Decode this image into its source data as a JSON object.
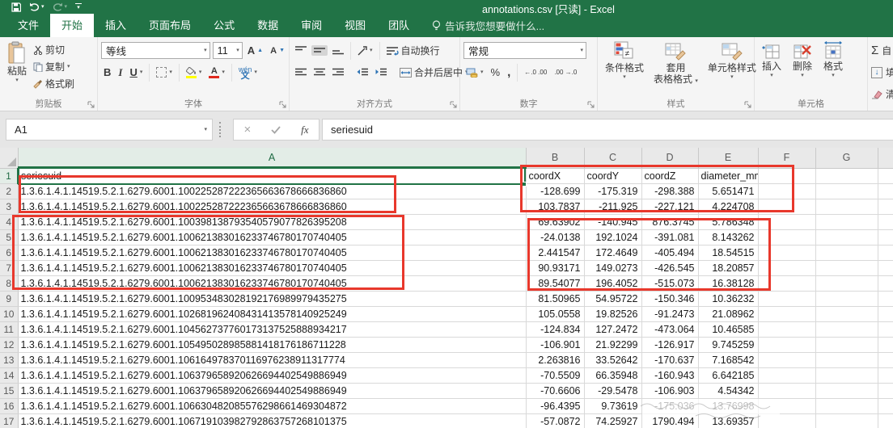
{
  "colors": {
    "excel_green": "#217346",
    "annotation_red": "#E8382C",
    "selection_green": "#217346"
  },
  "title_bar": {
    "title": "annotations.csv  [只读] - Excel"
  },
  "qat": {
    "icons": [
      "save-icon",
      "undo-icon",
      "redo-icon",
      "customize-quick-access-icon"
    ]
  },
  "ribbon": {
    "tabs": [
      {
        "label": "文件",
        "active": false
      },
      {
        "label": "开始",
        "active": true
      },
      {
        "label": "插入",
        "active": false
      },
      {
        "label": "页面布局",
        "active": false
      },
      {
        "label": "公式",
        "active": false
      },
      {
        "label": "数据",
        "active": false
      },
      {
        "label": "审阅",
        "active": false
      },
      {
        "label": "视图",
        "active": false
      },
      {
        "label": "团队",
        "active": false
      }
    ],
    "tell_me": "告诉我您想要做什么...",
    "clipboard": {
      "group_label": "剪贴板",
      "paste": "粘贴",
      "cut": "剪切",
      "copy": "复制",
      "format_painter": "格式刷"
    },
    "font": {
      "group_label": "字体",
      "font_name": "等线",
      "font_size": "11",
      "bold": "B",
      "italic": "I",
      "underline": "U",
      "phonetic_top": "wén",
      "phonetic_bottom": "文"
    },
    "alignment": {
      "group_label": "对齐方式",
      "wrap_text": "自动换行",
      "merge_center": "合并后居中"
    },
    "number": {
      "group_label": "数字",
      "format": "常规",
      "percent": "%",
      "comma": ",",
      "inc_decimal": "←.0 .00",
      "dec_decimal": ".00 →.0"
    },
    "styles": {
      "group_label": "样式",
      "conditional": "条件格式",
      "format_as_table_1": "套用",
      "format_as_table_2": "表格格式",
      "cell_styles": "单元格样式"
    },
    "cells": {
      "group_label": "单元格",
      "insert": "插入",
      "delete": "删除",
      "format": "格式"
    },
    "editing": {
      "autosum_sigma": "Σ",
      "autosum_partial": "自",
      "fill_partial": "填",
      "clear_partial": "清"
    }
  },
  "formula_bar": {
    "name_box": "A1",
    "fx": "fx",
    "formula": "seriesuid"
  },
  "grid": {
    "column_letters": [
      "A",
      "B",
      "C",
      "D",
      "E",
      "F",
      "G",
      ""
    ],
    "selected_cell": "A1",
    "rows": [
      {
        "n": "1",
        "cells": [
          "seriesuid",
          "coordX",
          "coordY",
          "coordZ",
          "diameter_mm"
        ]
      },
      {
        "n": "2",
        "cells": [
          "1.3.6.1.4.1.14519.5.2.1.6279.6001.100225287222365663678666836860",
          "-128.699",
          "-175.319",
          "-298.388",
          "5.651471"
        ]
      },
      {
        "n": "3",
        "cells": [
          "1.3.6.1.4.1.14519.5.2.1.6279.6001.100225287222365663678666836860",
          "103.7837",
          "-211.925",
          "-227.121",
          "4.224708"
        ]
      },
      {
        "n": "4",
        "cells": [
          "1.3.6.1.4.1.14519.5.2.1.6279.6001.100398138793540579077826395208",
          "69.63902",
          "-140.945",
          "876.3745",
          "5.786348"
        ]
      },
      {
        "n": "5",
        "cells": [
          "1.3.6.1.4.1.14519.5.2.1.6279.6001.100621383016233746780170740405",
          "-24.0138",
          "192.1024",
          "-391.081",
          "8.143262"
        ]
      },
      {
        "n": "6",
        "cells": [
          "1.3.6.1.4.1.14519.5.2.1.6279.6001.100621383016233746780170740405",
          "2.441547",
          "172.4649",
          "-405.494",
          "18.54515"
        ]
      },
      {
        "n": "7",
        "cells": [
          "1.3.6.1.4.1.14519.5.2.1.6279.6001.100621383016233746780170740405",
          "90.93171",
          "149.0273",
          "-426.545",
          "18.20857"
        ]
      },
      {
        "n": "8",
        "cells": [
          "1.3.6.1.4.1.14519.5.2.1.6279.6001.100621383016233746780170740405",
          "89.54077",
          "196.4052",
          "-515.073",
          "16.38128"
        ]
      },
      {
        "n": "9",
        "cells": [
          "1.3.6.1.4.1.14519.5.2.1.6279.6001.100953483028192176989979435275",
          "81.50965",
          "54.95722",
          "-150.346",
          "10.36232"
        ]
      },
      {
        "n": "10",
        "cells": [
          "1.3.6.1.4.1.14519.5.2.1.6279.6001.102681962408431413578140925249",
          "105.0558",
          "19.82526",
          "-91.2473",
          "21.08962"
        ]
      },
      {
        "n": "11",
        "cells": [
          "1.3.6.1.4.1.14519.5.2.1.6279.6001.104562737760173137525888934217",
          "-124.834",
          "127.2472",
          "-473.064",
          "10.46585"
        ]
      },
      {
        "n": "12",
        "cells": [
          "1.3.6.1.4.1.14519.5.2.1.6279.6001.105495028985881418176186711228",
          "-106.901",
          "21.92299",
          "-126.917",
          "9.745259"
        ]
      },
      {
        "n": "13",
        "cells": [
          "1.3.6.1.4.1.14519.5.2.1.6279.6001.106164978370116976238911317774",
          "2.263816",
          "33.52642",
          "-170.637",
          "7.168542"
        ]
      },
      {
        "n": "14",
        "cells": [
          "1.3.6.1.4.1.14519.5.2.1.6279.6001.106379658920626694402549886949",
          "-70.5509",
          "66.35948",
          "-160.943",
          "6.642185"
        ]
      },
      {
        "n": "15",
        "cells": [
          "1.3.6.1.4.1.14519.5.2.1.6279.6001.106379658920626694402549886949",
          "-70.6606",
          "-29.5478",
          "-106.903",
          "4.54342"
        ]
      },
      {
        "n": "16",
        "cells": [
          "1.3.6.1.4.1.14519.5.2.1.6279.6001.106630482085576298661469304872",
          "-96.4395",
          "9.73619",
          "-175.036",
          "13.76998"
        ]
      },
      {
        "n": "17",
        "cells": [
          "1.3.6.1.4.1.14519.5.2.1.6279.6001.106719103982792863757268101375",
          "-57.0872",
          "74.25927",
          "1790.494",
          "13.69357"
        ]
      }
    ]
  }
}
